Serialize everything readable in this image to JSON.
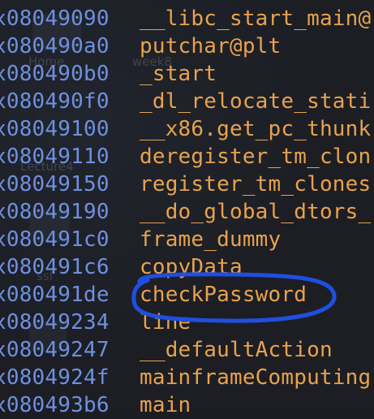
{
  "background_labels": {
    "home": "Home",
    "week8": "week8",
    "lecture4": "Lecture4",
    "ssl": "ssl"
  },
  "symbols": [
    {
      "address": "x08049090",
      "name": "__libc_start_main@"
    },
    {
      "address": "x080490a0",
      "name": "putchar@plt"
    },
    {
      "address": "x080490b0",
      "name": "_start"
    },
    {
      "address": "x080490f0",
      "name": "_dl_relocate_stati"
    },
    {
      "address": "x08049100",
      "name": "__x86.get_pc_thunk"
    },
    {
      "address": "x08049110",
      "name": "deregister_tm_clon"
    },
    {
      "address": "x08049150",
      "name": "register_tm_clones"
    },
    {
      "address": "x08049190",
      "name": "__do_global_dtors_"
    },
    {
      "address": "x080491c0",
      "name": "frame_dummy"
    },
    {
      "address": "x080491c6",
      "name": "copyData"
    },
    {
      "address": "x080491de",
      "name": "checkPassword"
    },
    {
      "address": "x08049234",
      "name": "line"
    },
    {
      "address": "x08049247",
      "name": "__defaultAction"
    },
    {
      "address": "x0804924f",
      "name": "mainframeComputing"
    },
    {
      "address": "x080493b6",
      "name": "main"
    }
  ],
  "highlight": {
    "symbol": "checkPassword",
    "color": "#1f4fe0"
  },
  "colors": {
    "address": "#6f8fe0",
    "symbol": "#e8a24e",
    "background": "#1c1e24"
  }
}
